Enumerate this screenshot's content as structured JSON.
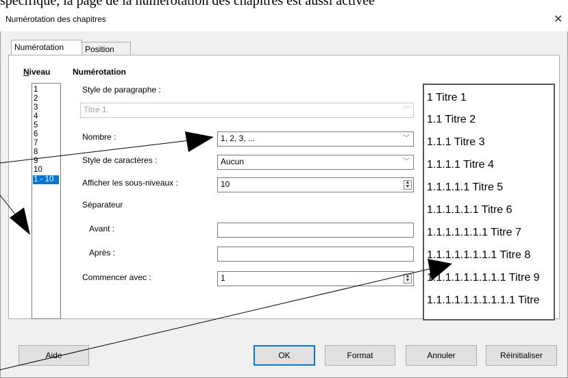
{
  "background_text": "spécifique, la page de la numérotation des chapitres est aussi activée",
  "window": {
    "title": "Numérotation des chapitres",
    "close_glyph": "✕"
  },
  "tabs": [
    {
      "label": "Numérotation",
      "active": true
    },
    {
      "label": "Position",
      "active": false
    }
  ],
  "levels": {
    "header": "Niveau",
    "items": [
      "1",
      "2",
      "3",
      "4",
      "5",
      "6",
      "7",
      "8",
      "9",
      "10",
      "1 - 10"
    ],
    "selected": "1 - 10"
  },
  "numbering": {
    "header": "Numérotation",
    "paragraph_style": {
      "label": "Style de paragraphe :",
      "value": "Titre 1"
    },
    "number": {
      "label": "Nombre :",
      "value": "1, 2, 3, ..."
    },
    "char_style": {
      "label": "Style de caractères :",
      "value": "Aucun"
    },
    "sublevels": {
      "label": "Afficher les sous-niveaux :",
      "value": "10"
    },
    "separator": {
      "label": "Séparateur",
      "before": {
        "label": "Avant :",
        "value": ""
      },
      "after": {
        "label": "Après :",
        "value": ""
      }
    },
    "start_with": {
      "label": "Commencer avec :",
      "value": "1"
    }
  },
  "preview": [
    "1 Titre 1",
    "1.1 Titre 2",
    "1.1.1 Titre 3",
    "1.1.1.1 Titre 4",
    "1.1.1.1.1 Titre 5",
    "1.1.1.1.1.1 Titre 6",
    "1.1.1.1.1.1.1 Titre 7",
    "1.1.1.1.1.1.1.1 Titre 8",
    "1.1.1.1.1.1.1.1.1 Titre 9",
    "1.1.1.1.1.1.1.1.1.1 Titre"
  ],
  "buttons": {
    "help": "Aide",
    "ok": "OK",
    "format": "Format",
    "cancel": "Annuler",
    "reset": "Réinitialiser"
  },
  "colors": {
    "accent": "#0078d7",
    "arrow": "#000000"
  }
}
